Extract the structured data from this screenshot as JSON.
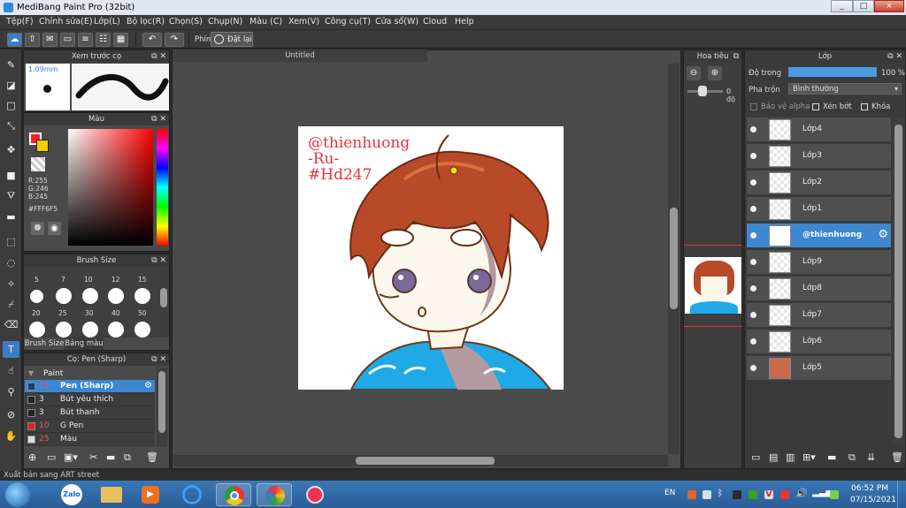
{
  "window": {
    "title": "MediBang Paint Pro (32bit)",
    "min": "_",
    "max": "□",
    "close": "×"
  },
  "menu": [
    "Tệp(F)",
    "Chỉnh sửa(E)",
    "Lớp(L)",
    "Bộ lọc(R)",
    "Chọn(S)",
    "Chụp(N)",
    "Màu (C)",
    "Xem(V)",
    "Công cụ(T)",
    "Cửa sổ(W)",
    "Cloud",
    "Help"
  ],
  "toolbar": {
    "shortcut_label": "Phím",
    "reset_label": "Đặt lại"
  },
  "preview": {
    "title": "Xem trước cọ",
    "size": "1.09mm"
  },
  "color": {
    "title": "Màu",
    "r": "R:255",
    "g": "G:246",
    "b": "B:245",
    "hex": "#FFF6F5",
    "fg": "#ff2020",
    "bg": "#f0d000"
  },
  "brush_size": {
    "title": "Brush Size",
    "row1": [
      "5",
      "7",
      "10",
      "12",
      "15"
    ],
    "row2": [
      "20",
      "25",
      "30",
      "40",
      "50"
    ],
    "tab1": "Brush Size",
    "tab2": "Bảng màu"
  },
  "brush_panel": {
    "title": "Cọ: Pen (Sharp)",
    "group": "Paint",
    "items": [
      {
        "size": "15",
        "name": "Pen (Sharp)",
        "color": "#1f3d6a"
      },
      {
        "size": "3",
        "name": "Bút yêu thích",
        "color": "#222222"
      },
      {
        "size": "3",
        "name": "Bút thanh",
        "color": "#222222"
      },
      {
        "size": "10",
        "name": "G Pen",
        "color": "#e02020"
      },
      {
        "size": "25",
        "name": "Màu",
        "color": "#dddddd"
      }
    ]
  },
  "canvas": {
    "tab": "Untitled",
    "text1": "@thienhuong",
    "text2": "-Ru-",
    "text3": "#Hd247"
  },
  "navigator": {
    "title": "Hoa tiêu",
    "angle": "0 độ"
  },
  "layers": {
    "title": "Lớp",
    "opacity_label": "Độ trong",
    "opacity_value": "100 %",
    "blend_label": "Pha trộn",
    "blend_value": "Bình thường",
    "protect_alpha": "Bảo vệ alpha",
    "clipping": "Xén bớt",
    "lock": "Khóa",
    "items": [
      "Lớp4",
      "Lớp3",
      "Lớp2",
      "Lớp1",
      "@thienhuong",
      "Lớp9",
      "Lớp8",
      "Lớp7",
      "Lớp6",
      "Lớp5"
    ]
  },
  "status": {
    "text": "Xuất bản sang ART street"
  },
  "taskbar": {
    "lang": "EN",
    "time": "06:52 PM",
    "date": "07/15/2021",
    "zalo": "Zalo"
  }
}
